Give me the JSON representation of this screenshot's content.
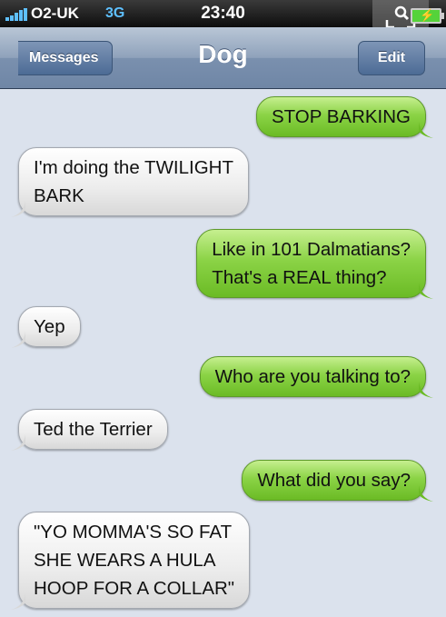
{
  "status_bar": {
    "carrier": "O2-UK",
    "network": "3G",
    "time": "23:40"
  },
  "nav": {
    "back_label": "Messages",
    "title": "Dog",
    "edit_label": "Edit"
  },
  "messages": [
    {
      "from": "me",
      "lines": [
        "STOP BARKING"
      ]
    },
    {
      "from": "them",
      "lines": [
        "I'm doing the TWILIGHT",
        "BARK"
      ]
    },
    {
      "from": "me",
      "lines": [
        "Like in 101 Dalmatians?",
        "That's a REAL thing?"
      ]
    },
    {
      "from": "them",
      "lines": [
        "Yep"
      ]
    },
    {
      "from": "me",
      "lines": [
        "Who are you talking to?"
      ]
    },
    {
      "from": "them",
      "lines": [
        "Ted the Terrier"
      ]
    },
    {
      "from": "me",
      "lines": [
        "What did you say?"
      ]
    },
    {
      "from": "them",
      "lines": [
        "\"YO MOMMA'S SO FAT",
        "SHE WEARS A HULA",
        "HOOP FOR A COLLAR\""
      ]
    }
  ],
  "colors": {
    "sent_bubble": "#8bd346",
    "received_bubble": "#ececec",
    "navbar": "#6f86a6",
    "background": "#dbe2ed"
  }
}
